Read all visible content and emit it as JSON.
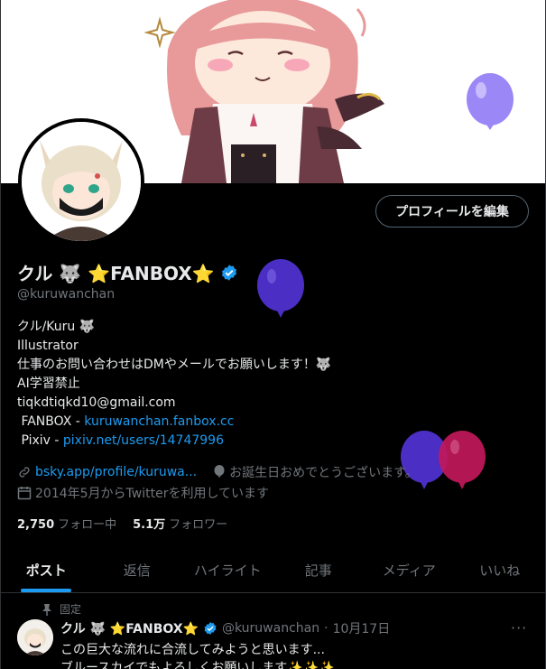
{
  "profile": {
    "display_name": "クル 🐺 ⭐FANBOX⭐",
    "handle": "@kuruwanchan",
    "edit_button": "プロフィールを編集",
    "bio": {
      "line1": "クル/Kuru 🐺",
      "line2": "Illustrator",
      "line3": "仕事のお問い合わせはDMやメールでお願いします！🐺",
      "line4": "AI学習禁止",
      "line5": "tiqkdtiqkd10@gmail.com",
      "fanbox_label": " FANBOX - ",
      "fanbox_link": "kuruwanchan.fanbox.cc",
      "pixiv_label": " Pixiv - ",
      "pixiv_link": "pixiv.net/users/14747996"
    },
    "website": "bsky.app/profile/kuruwa...",
    "birthday": "お誕生日おめでとうございます。",
    "joined": "2014年5月からTwitterを利用しています",
    "following_count": "2,750",
    "following_label": "フォロー中",
    "followers_count": "5.1万",
    "followers_label": "フォロワー"
  },
  "tabs": [
    {
      "label": "ポスト"
    },
    {
      "label": "返信"
    },
    {
      "label": "ハイライト"
    },
    {
      "label": "記事"
    },
    {
      "label": "メディア"
    },
    {
      "label": "いいね"
    }
  ],
  "pinned_post": {
    "pinned_label": "固定",
    "author_name": "クル 🐺 ⭐FANBOX⭐",
    "author_handle": "@kuruwanchan",
    "dot": "·",
    "date": "10月17日",
    "more": "···",
    "line1": "この巨大な流れに合流してみようと思います...",
    "line2": "ブルースカイでもよろしくお願いします✨✨✨"
  },
  "colors": {
    "accent": "#1d9bf0",
    "balloon_light": "#9b87f5",
    "balloon_dark": "#4b2fc4",
    "balloon_pink": "#c2185b"
  },
  "icons": [
    "link-icon",
    "balloon-icon",
    "calendar-icon",
    "verified-badge-icon",
    "pin-icon",
    "more-icon"
  ]
}
